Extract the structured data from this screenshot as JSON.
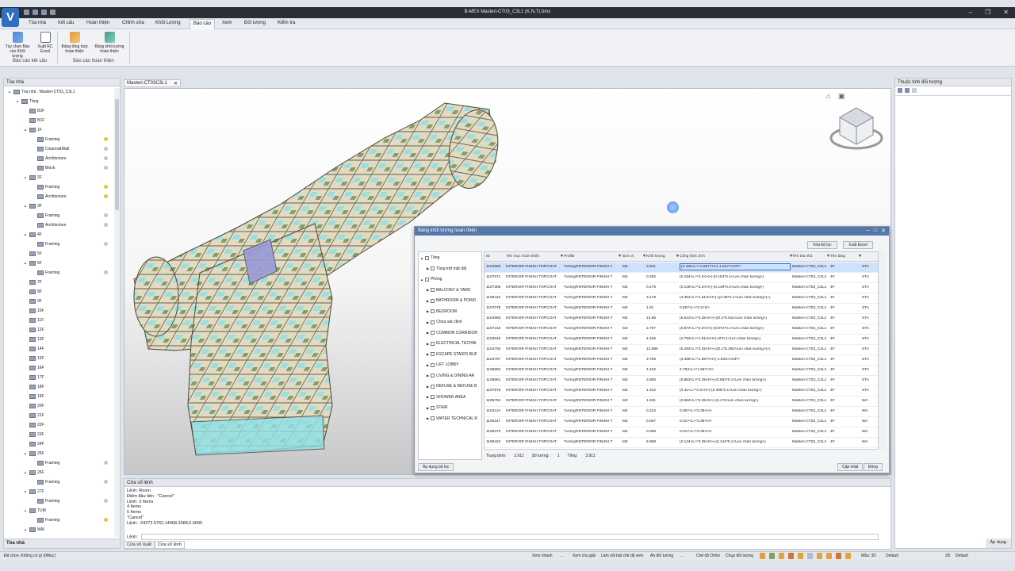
{
  "window": {
    "title": "B-MEX Masteri-CT03_C3L1 (K,N,T).bmx",
    "logo": "V"
  },
  "menu": [
    "Tòa nhà",
    "Kết cấu",
    "Hoàn thiện",
    "Chỉnh sửa",
    "Khối Lượng",
    "Báo cáo",
    "Xem",
    "Đối tượng",
    "Kiểm tra"
  ],
  "menu_active_index": 5,
  "ribbon": {
    "buttons": [
      "Tùy chọn Báo cáo Khối lượng",
      "Xuất RC Excel",
      "Bảng tổng hợp hoàn thiện",
      "Bảng khối lượng hoàn thiện"
    ],
    "groups": [
      "Báo cáo kết cấu",
      "Báo cáo hoàn thiện"
    ]
  },
  "left_panel": {
    "title": "Tòa nhà",
    "footer": "Tòa nhà",
    "tree": [
      {
        "label": "Tòa nhà : Masteri-CT03_C3L1",
        "lvl": 0,
        "arrow": "▲",
        "icon": "building-icon"
      },
      {
        "label": "Tầng",
        "lvl": 1,
        "arrow": "▲",
        "icon": "levels-icon"
      },
      {
        "label": "B2F",
        "lvl": 2,
        "arrow": "",
        "icon": "level-icon"
      },
      {
        "label": "B1F",
        "lvl": 2,
        "arrow": "",
        "icon": "level-icon"
      },
      {
        "label": "1F",
        "lvl": 2,
        "arrow": "▲",
        "icon": "level-icon"
      },
      {
        "label": "Framing",
        "lvl": 3,
        "arrow": "",
        "icon": "framing-icon",
        "bulb": "y"
      },
      {
        "label": "Column&Wall",
        "lvl": 3,
        "arrow": "",
        "icon": "column-wall-icon",
        "bulb": "b"
      },
      {
        "label": "Architecture",
        "lvl": 3,
        "arrow": "",
        "icon": "architecture-icon",
        "bulb": "b"
      },
      {
        "label": "Block",
        "lvl": 3,
        "arrow": "",
        "icon": "block-icon",
        "bulb": "b"
      },
      {
        "label": "2F",
        "lvl": 2,
        "arrow": "▲",
        "icon": "level-icon"
      },
      {
        "label": "Framing",
        "lvl": 3,
        "arrow": "",
        "icon": "framing-icon",
        "bulb": "y"
      },
      {
        "label": "Architecture",
        "lvl": 3,
        "arrow": "",
        "icon": "architecture-icon",
        "bulb": "y"
      },
      {
        "label": "3F",
        "lvl": 2,
        "arrow": "▲",
        "icon": "level-icon"
      },
      {
        "label": "Framing",
        "lvl": 3,
        "arrow": "",
        "icon": "framing-icon",
        "bulb": "b"
      },
      {
        "label": "Architecture",
        "lvl": 3,
        "arrow": "",
        "icon": "architecture-icon",
        "bulb": "b"
      },
      {
        "label": "4F",
        "lvl": 2,
        "arrow": "▲",
        "icon": "level-icon"
      },
      {
        "label": "Framing",
        "lvl": 3,
        "arrow": "",
        "icon": "framing-icon",
        "bulb": "b"
      },
      {
        "label": "5F",
        "lvl": 2,
        "arrow": "",
        "icon": "level-icon"
      },
      {
        "label": "6F",
        "lvl": 2,
        "arrow": "▲",
        "icon": "level-icon"
      },
      {
        "label": "Framing",
        "lvl": 3,
        "arrow": "",
        "icon": "framing-icon",
        "bulb": "b"
      },
      {
        "label": "7F",
        "lvl": 2,
        "arrow": "",
        "icon": "level-icon"
      },
      {
        "label": "8F",
        "lvl": 2,
        "arrow": "",
        "icon": "level-icon"
      },
      {
        "label": "9F",
        "lvl": 2,
        "arrow": "",
        "icon": "level-icon"
      },
      {
        "label": "10F",
        "lvl": 2,
        "arrow": "",
        "icon": "level-icon"
      },
      {
        "label": "11F",
        "lvl": 2,
        "arrow": "",
        "icon": "level-icon"
      },
      {
        "label": "12F",
        "lvl": 2,
        "arrow": "",
        "icon": "level-icon"
      },
      {
        "label": "13F",
        "lvl": 2,
        "arrow": "",
        "icon": "level-icon"
      },
      {
        "label": "14F",
        "lvl": 2,
        "arrow": "",
        "icon": "level-icon"
      },
      {
        "label": "15F",
        "lvl": 2,
        "arrow": "",
        "icon": "level-icon"
      },
      {
        "label": "16F",
        "lvl": 2,
        "arrow": "",
        "icon": "level-icon"
      },
      {
        "label": "17F",
        "lvl": 2,
        "arrow": "",
        "icon": "level-icon"
      },
      {
        "label": "18F",
        "lvl": 2,
        "arrow": "",
        "icon": "level-icon"
      },
      {
        "label": "19F",
        "lvl": 2,
        "arrow": "",
        "icon": "level-icon"
      },
      {
        "label": "20F",
        "lvl": 2,
        "arrow": "",
        "icon": "level-icon"
      },
      {
        "label": "21F",
        "lvl": 2,
        "arrow": "",
        "icon": "level-icon"
      },
      {
        "label": "22F",
        "lvl": 2,
        "arrow": "",
        "icon": "level-icon"
      },
      {
        "label": "23F",
        "lvl": 2,
        "arrow": "",
        "icon": "level-icon"
      },
      {
        "label": "24F",
        "lvl": 2,
        "arrow": "",
        "icon": "level-icon"
      },
      {
        "label": "25F",
        "lvl": 2,
        "arrow": "▲",
        "icon": "level-icon"
      },
      {
        "label": "Framing",
        "lvl": 3,
        "arrow": "",
        "icon": "framing-icon",
        "bulb": "b"
      },
      {
        "label": "26F",
        "lvl": 2,
        "arrow": "▲",
        "icon": "level-icon"
      },
      {
        "label": "Framing",
        "lvl": 3,
        "arrow": "",
        "icon": "framing-icon",
        "bulb": "b"
      },
      {
        "label": "27F",
        "lvl": 2,
        "arrow": "▲",
        "icon": "level-icon"
      },
      {
        "label": "Framing",
        "lvl": 3,
        "arrow": "",
        "icon": "framing-icon",
        "bulb": "b"
      },
      {
        "label": "TUM",
        "lvl": 2,
        "arrow": "▲",
        "icon": "level-icon"
      },
      {
        "label": "Framing",
        "lvl": 3,
        "arrow": "",
        "icon": "framing-icon",
        "bulb": "y"
      },
      {
        "label": "MÁI",
        "lvl": 2,
        "arrow": "▲",
        "icon": "level-icon"
      }
    ]
  },
  "viewport": {
    "tab": "Masteri-CT03C3L1"
  },
  "table_window": {
    "title": "Bảng khối lượng hoàn thiện",
    "buttons": {
      "clear_filter": "Xóa bộ lọc",
      "export_excel": "Xuất Excel",
      "apply_filter": "Áp dụng bộ lọc",
      "update": "Cập nhật",
      "close": "Đóng"
    },
    "filter_tree": [
      {
        "label": "Tầng",
        "lvl": 0,
        "arrow": "▲"
      },
      {
        "label": "Tầng trệt mặt đất",
        "lvl": 1,
        "arrow": "▶"
      },
      {
        "label": "Phòng",
        "lvl": 0,
        "arrow": "▲"
      },
      {
        "label": "BALCONY & YARD",
        "lvl": 1,
        "arrow": "▶"
      },
      {
        "label": "BATHROOM & POWD",
        "lvl": 1,
        "arrow": "▶"
      },
      {
        "label": "BEDROOM",
        "lvl": 1,
        "arrow": "▶"
      },
      {
        "label": "Chưa xác định",
        "lvl": 1,
        "arrow": "▶"
      },
      {
        "label": "COMMON CORRIDOR",
        "lvl": 1,
        "arrow": "▶"
      },
      {
        "label": "ELECTRICAL TECHNI",
        "lvl": 1,
        "arrow": "▶"
      },
      {
        "label": "ESCAPE STAIR'S BUF",
        "lvl": 1,
        "arrow": "▶"
      },
      {
        "label": "LIFT LOBBY",
        "lvl": 1,
        "arrow": "▶"
      },
      {
        "label": "LIVING & DINING AR",
        "lvl": 1,
        "arrow": "▶"
      },
      {
        "label": "REFUSE & REFUSE B",
        "lvl": 1,
        "arrow": "▶"
      },
      {
        "label": "SHOWER AREA",
        "lvl": 1,
        "arrow": "▶"
      },
      {
        "label": "STAIR",
        "lvl": 1,
        "arrow": "▶"
      },
      {
        "label": "WATER TECHNICAL R",
        "lvl": 1,
        "arrow": "▶"
      }
    ],
    "columns": [
      "ID",
      "Tên mục hoàn thiện",
      "Profile",
      "Đơn vị",
      "Khối lượng",
      "Công thức tính",
      "Tên tòa nhà",
      "Tên tầng",
      ""
    ],
    "rows": [
      [
        "1101866",
        "INTERIOR FINISH TOPCOAT",
        "Tường#INTERIOR FINISH T",
        "M2",
        "3.911",
        "(3.496<L>*1.587<H>)-1.637<AOP>",
        "Masteri-CT03_C3L1",
        "4F",
        "STA"
      ],
      [
        "1107671",
        "INTERIOR FINISH TOPCOAT",
        "Tường#INTERIOR FINISH T",
        "M2",
        "0.492",
        "(0.154<L>*3.3<H>)-(0.154*0.1<Len chân tường>)",
        "Masteri-CT03_C3L1",
        "4F",
        "STA"
      ],
      [
        "1107308",
        "INTERIOR FINISH TOPCOAT",
        "Tường#INTERIOR FINISH T",
        "M2",
        "0.478",
        "(0.149<L>*3.3<H>)-(0.149*0.1<Len chân tường>)",
        "Masteri-CT03_C3L1",
        "4F",
        "STA"
      ],
      [
        "1108410",
        "INTERIOR FINISH TOPCOAT",
        "Tường#INTERIOR FINISH T",
        "M2",
        "3.179",
        "(3.351<L>*1.613<H>)-((3.35*0.1<Len chân tường>)+(",
        "Masteri-CT03_C3L1",
        "4F",
        "STA"
      ],
      [
        "1107076",
        "INTERIOR FINISH TOPCOAT",
        "Tường#INTERIOR FINISH T",
        "M2",
        "1.91",
        "0.597<L>*3.2<H>",
        "Masteri-CT03_C3L1",
        "4F",
        "STA"
      ],
      [
        "1104965",
        "INTERIOR FINISH TOPCOAT",
        "Tường#INTERIOR FINISH T",
        "M2",
        "13.85",
        "(5.513<L>*3.35<H>)-((0.1*5.511<Len chân tường>)",
        "Masteri-CT03_C3L1",
        "4F",
        "STA"
      ],
      [
        "1107318",
        "INTERIOR FINISH TOPCOAT",
        "Tường#INTERIOR FINISH T",
        "M2",
        "2.797",
        "(0.874<L>*3.3<H>)-(0.874*0.1<Len chân tường>)",
        "Masteri-CT03_C3L1",
        "4F",
        "STA"
      ],
      [
        "1103646",
        "INTERIOR FINISH TOPCOAT",
        "Tường#INTERIOR FINISH T",
        "M2",
        "4.226",
        "(2.793<L>*1.613<H>)-(0*0.1<Len chân tường>)",
        "Masteri-CT03_C3L1",
        "4F",
        "STA"
      ],
      [
        "1104792",
        "INTERIOR FINISH TOPCOAT",
        "Tường#INTERIOR FINISH T",
        "M2",
        "12.986",
        "(5.292<L>*3.25<H>)-((0.1*5.292<Len chân tường>)+(",
        "Masteri-CT03_C3L1",
        "4F",
        "STA"
      ],
      [
        "1104797",
        "INTERIOR FINISH TOPCOAT",
        "Tường#INTERIOR FINISH T",
        "M2",
        "3.706",
        "(3.496<L>*1.587<H>)-1.842<AOP>",
        "Masteri-CT03_C3L1",
        "4F",
        "STA"
      ],
      [
        "1105892",
        "INTERIOR FINISH TOPCOAT",
        "Tường#INTERIOR FINISH T",
        "M2",
        "4.432",
        "2.793<L>*1.587<H>",
        "Masteri-CT03_C3L1",
        "4F",
        "STA"
      ],
      [
        "1108981",
        "INTERIOR FINISH TOPCOAT",
        "Tường#INTERIOR FINISH T",
        "M2",
        "2.805",
        "(0.863<L>*3.35<H>)-(0.863*0.1<Len chân tường>)",
        "Masteri-CT03_C3L1",
        "4F",
        "STA"
      ],
      [
        "1107676",
        "INTERIOR FINISH TOPCOAT",
        "Tường#INTERIOR FINISH T",
        "M2",
        "1.312",
        "(0.41<L>*3.3<H>)-(0.408*0.1<Len chân tường>)",
        "Masteri-CT03_C3L1",
        "4F",
        "STA"
      ],
      [
        "1105782",
        "INTERIOR FINISH TOPCOAT",
        "Tường#INTERIOR FINISH T",
        "M2",
        "1.931",
        "(0.594<L>*3.35<H>)-(0.1*0<Len chân tường>)",
        "Masteri-CT03_C3L1",
        "4F",
        "WA"
      ],
      [
        "1103124",
        "INTERIOR FINISH TOPCOAT",
        "Tường#INTERIOR FINISH T",
        "M2",
        "0.224",
        "0.067<L>*3.35<H>",
        "Masteri-CT03_C3L1",
        "4F",
        "WA"
      ],
      [
        "1105317",
        "INTERIOR FINISH TOPCOAT",
        "Tường#INTERIOR FINISH T",
        "M2",
        "0.057",
        "0.017<L>*3.35<H>",
        "Masteri-CT03_C3L1",
        "4F",
        "WA"
      ],
      [
        "1105373",
        "INTERIOR FINISH TOPCOAT",
        "Tường#INTERIOR FINISH T",
        "M2",
        "0.058",
        "0.017<L>*3.39<H>",
        "Masteri-CT03_C3L1",
        "4F",
        "WA"
      ],
      [
        "1108422",
        "INTERIOR FINISH TOPCOAT",
        "Tường#INTERIOR FINISH T",
        "M2",
        "6.968",
        "(2.144<L>*3.35<H>)-(2.144*0.1<Len chân tường>)",
        "Masteri-CT03_C3L1",
        "4F",
        "WA"
      ]
    ],
    "summary": {
      "avg_label": "Trung bình:",
      "avg": "3.911",
      "count_label": "Số lượng:",
      "count": "1",
      "sum_label": "Tổng:",
      "sum": "3.911"
    }
  },
  "right_panel": {
    "title": "Thuộc tính đối tượng",
    "footer": "Áp dụng"
  },
  "command_panel": {
    "title": "Cửa sổ lệnh",
    "log": [
      "Lệnh: Room",
      "Điểm đầu tiên : \"Cancel\"",
      "Lệnh: 3 Items",
      "  4 Items",
      "  5 Items",
      "  \"Cancel\"",
      "Lệnh: -24272.5762,14468.3388,0.0000"
    ],
    "prompt": "Lệnh:",
    "tabs": [
      "Cửa sổ Xuất",
      "Cửa sổ lệnh"
    ]
  },
  "statusbar": {
    "left": "Đã chọn :Không có gì (0Mục)",
    "items": [
      "Xem nhanh",
      "...",
      "Xem chú giải",
      "Làm nổi bật chế độ xem",
      "Ẩn đối tượng",
      "...",
      "Chế độ Ortho",
      "Chụp đối tượng",
      "Mẫu: 3D",
      "Default",
      "2D",
      "Default"
    ]
  },
  "colors": {
    "accent": "#2f6fc2",
    "title_bar": "#2b2e37",
    "table_header": "#5577aa",
    "selected_row": "#cfe2fb",
    "glass": "#8fe0e6",
    "wall": "#d8d0b4"
  }
}
